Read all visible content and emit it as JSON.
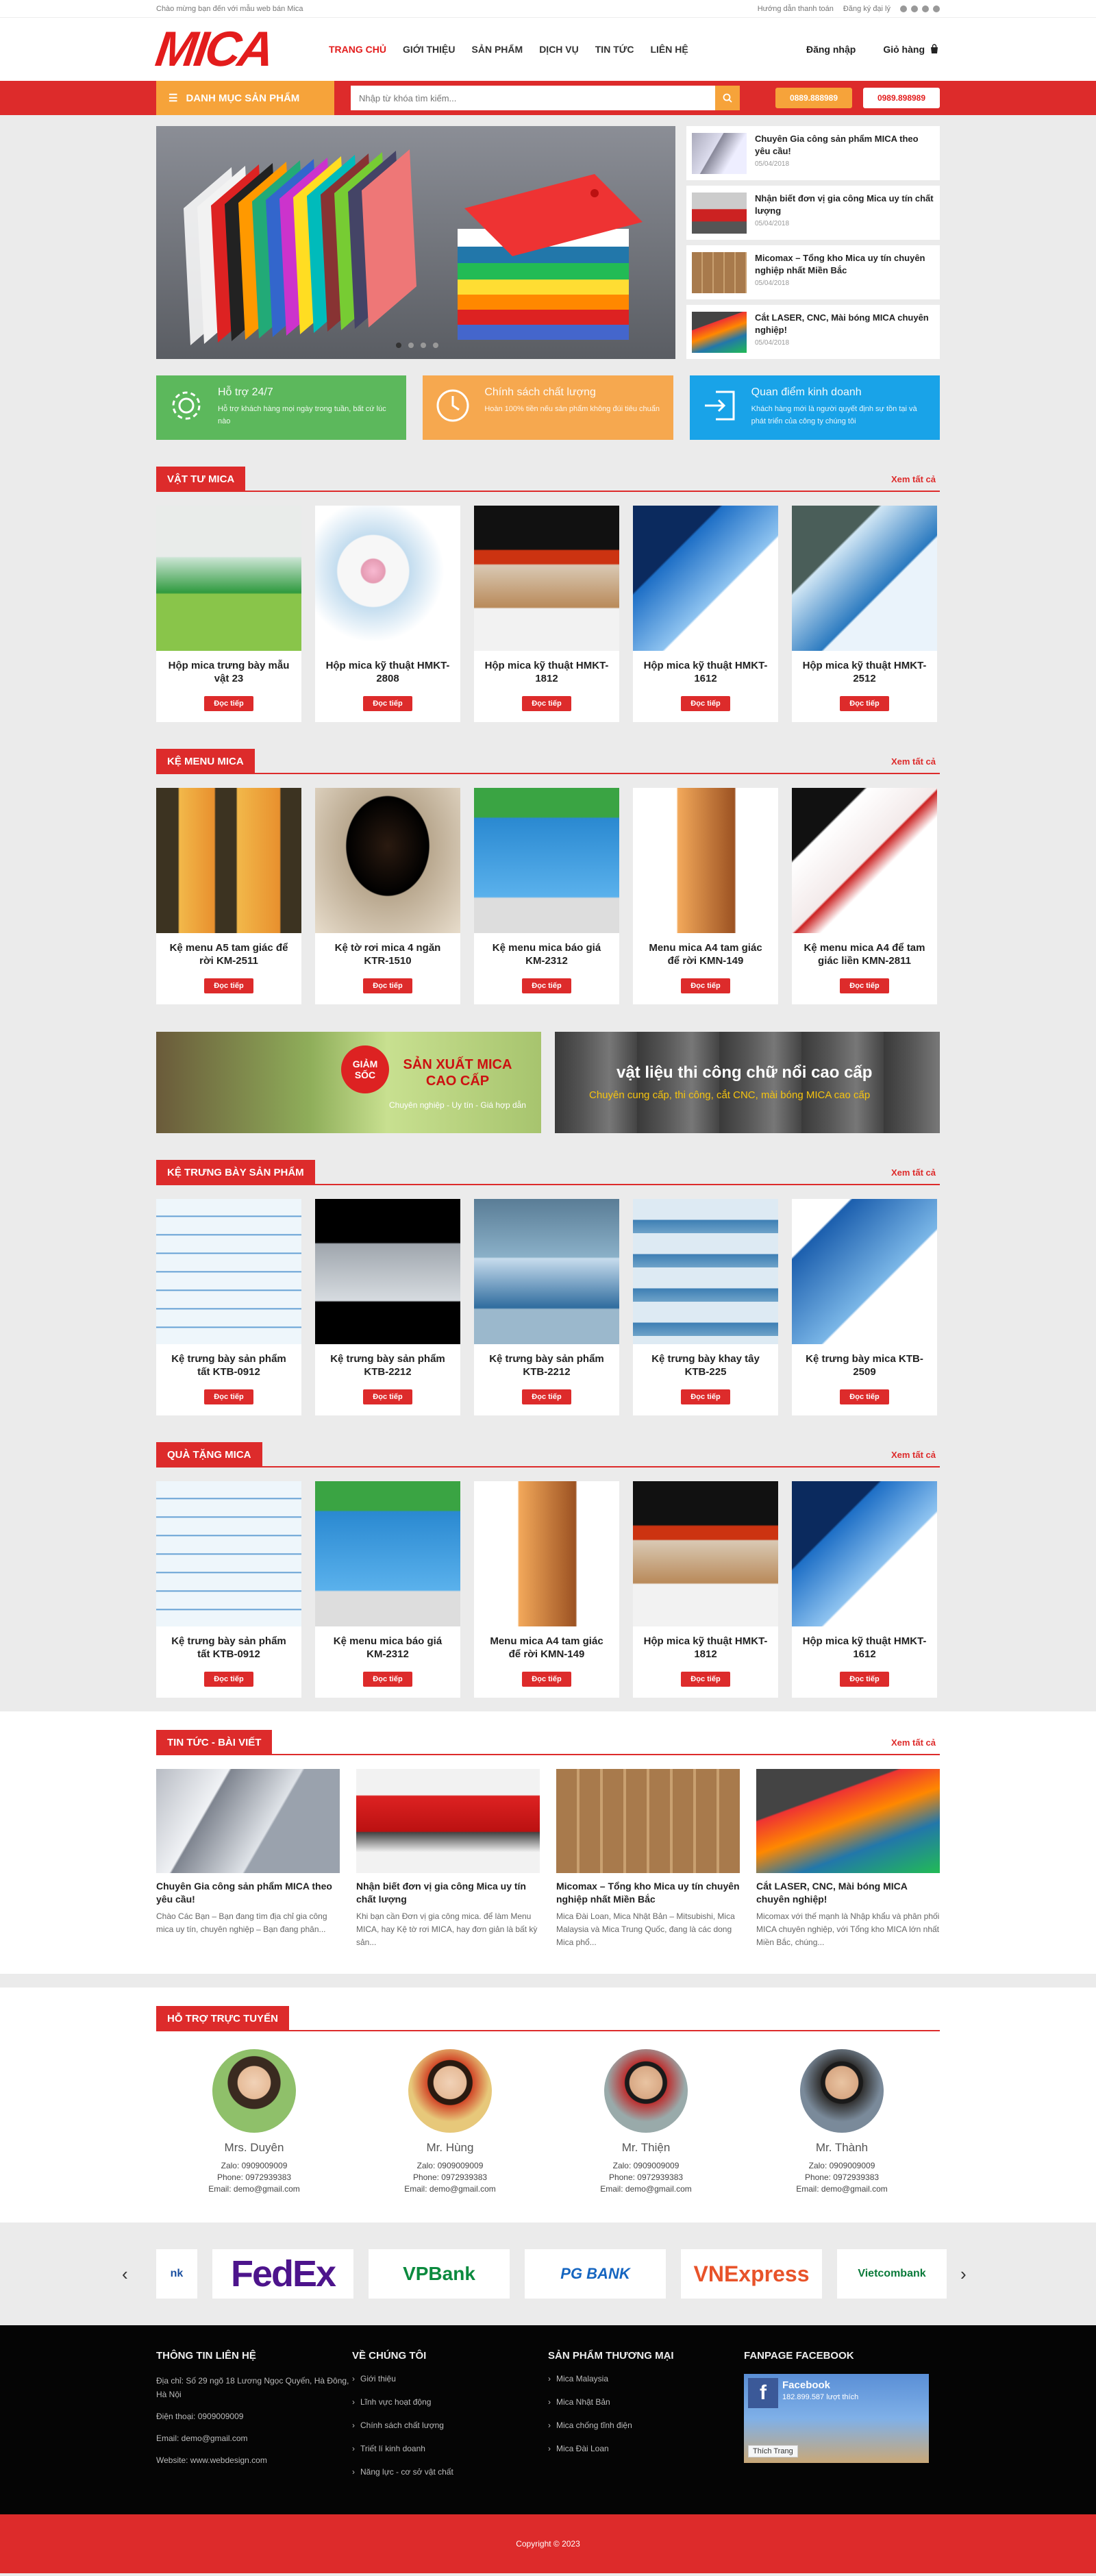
{
  "topbar": {
    "welcome": "Chào mừng bạn đến với mẫu web bán Mica",
    "guide": "Hướng dẫn thanh toán",
    "agent": "Đăng ký đại lý"
  },
  "nav": {
    "items": [
      "TRANG CHỦ",
      "GIỚI THIỆU",
      "SẢN PHẨM",
      "DỊCH VỤ",
      "TIN TỨC",
      "LIÊN HỆ"
    ],
    "login": "Đăng nhập",
    "cart": "Giỏ hàng"
  },
  "logo": "MICA",
  "search": {
    "category_label": "DANH MỤC SẢN PHẨM",
    "placeholder": "Nhập từ khóa tìm kiếm...",
    "phone1": "0889.888989",
    "phone2": "0989.898989"
  },
  "side_news": [
    {
      "title": "Chuyên Gia công sản phẩm MICA theo yêu cầu!",
      "date": "05/04/2018"
    },
    {
      "title": "Nhận biết đơn vị gia công Mica uy tín chất lượng",
      "date": "05/04/2018"
    },
    {
      "title": "Micomax – Tổng kho Mica uy tín chuyên nghiệp nhất Miền Bắc",
      "date": "05/04/2018"
    },
    {
      "title": "Cắt LASER, CNC, Mài bóng MICA chuyên nghiệp!",
      "date": "05/04/2018"
    }
  ],
  "features": [
    {
      "title": "Hỗ trợ 24/7",
      "text": "Hỗ trợ khách hàng mọi ngày trong tuần, bất cứ lúc nào",
      "color": "#5cb85c"
    },
    {
      "title": "Chính sách chất lượng",
      "text": "Hoàn 100% tiền nếu sản phẩm không đúi tiêu chuẩn",
      "color": "#f6a84f"
    },
    {
      "title": "Quan điểm kinh doanh",
      "text": "Khách hàng mới là người quyết định sự tồn tại và phát triển của công ty chúng tôi",
      "color": "#19a3e8"
    }
  ],
  "common": {
    "more": "Xem tất cả",
    "detail": "Đọc tiếp"
  },
  "sections": [
    {
      "title": "VẬT TƯ MICA",
      "items": [
        "Hộp mica trưng bày mẫu vật 23",
        "Hộp mica kỹ thuật HMKT-2808",
        "Hộp mica kỹ thuật HMKT-1812",
        "Hộp mica kỹ thuật HMKT-1612",
        "Hộp mica kỹ thuật HMKT-2512"
      ]
    },
    {
      "title": "KỆ MENU MICA",
      "items": [
        "Kệ menu A5 tam giác để rời KM-2511",
        "Kệ tờ rơi mica 4 ngăn KTR-1510",
        "Kệ menu mica báo giá KM-2312",
        "Menu mica A4 tam giác để rời KMN-149",
        "Kệ menu mica A4 để tam giác liền KMN-2811"
      ]
    },
    {
      "title": "KỆ TRƯNG BÀY SẢN PHẨM",
      "items": [
        "Kệ trưng bày sản phẩm tất KTB-0912",
        "Kệ trưng bày sản phẩm KTB-2212",
        "Kệ trưng bày sản phẩm KTB-2212",
        "Kệ trưng bày khay tây KTB-225",
        "Kệ trưng bày mica KTB-2509"
      ]
    },
    {
      "title": "QUÀ TẶNG MICA",
      "items": [
        "Kệ trưng bày sản phẩm tất KTB-0912",
        "Kệ menu mica báo giá KM-2312",
        "Menu mica A4 tam giác để rời KMN-149",
        "Hộp mica kỹ thuật HMKT-1812",
        "Hộp mica kỹ thuật HMKT-1612"
      ]
    }
  ],
  "banners": {
    "left_badge": "GIẢM SỐC",
    "left_title": "SẢN XUẤT MICA CAO CẤP",
    "left_sub": "Chuyên nghiệp - Uy tín - Giá hợp dẫn",
    "right_title": "vật liệu thi công chữ nổi cao cấp",
    "right_sub": "Chuyên cung cấp, thi công, cắt CNC, mài bóng MICA cao cấp"
  },
  "news": {
    "title": "TIN TỨC - BÀI VIẾT",
    "items": [
      {
        "title": "Chuyên Gia công sản phẩm MICA theo yêu cầu!",
        "excerpt": "Chào Các Bạn – Bạn đang tìm địa chỉ gia công mica uy tín, chuyên nghiệp – Bạn đang phân..."
      },
      {
        "title": "Nhận biết đơn vị gia công Mica uy tín chất lượng",
        "excerpt": "Khi bạn cần Đơn vị gia công mica. để làm Menu MICA, hay Kệ tờ rơi MICA, hay đơn giản là bất kỳ sản..."
      },
      {
        "title": "Micomax – Tổng kho Mica uy tín chuyên nghiệp nhất Miền Bắc",
        "excerpt": "Mica Đài Loan, Mica Nhật Bản – Mitsubishi, Mica Malaysia và Mica Trung Quốc, đang là các dong Mica phổ..."
      },
      {
        "title": "Cắt LASER, CNC, Mài bóng MICA chuyên nghiệp!",
        "excerpt": "Micomax với thế mạnh là Nhập khẩu và phân phối MICA chuyên nghiệp, với Tổng kho MICA lớn nhất Miền Bắc, chúng..."
      }
    ]
  },
  "support": {
    "title": "HỖ TRỢ TRỰC TUYẾN",
    "people": [
      {
        "name": "Mrs. Duyên",
        "zalo": "Zalo: 0909009009",
        "phone": "Phone: 0972939383",
        "email": "Email: demo@gmail.com"
      },
      {
        "name": "Mr. Hùng",
        "zalo": "Zalo: 0909009009",
        "phone": "Phone: 0972939383",
        "email": "Email: demo@gmail.com"
      },
      {
        "name": "Mr. Thiện",
        "zalo": "Zalo: 0909009009",
        "phone": "Phone: 0972939383",
        "email": "Email: demo@gmail.com"
      },
      {
        "name": "Mr. Thành",
        "zalo": "Zalo: 0909009009",
        "phone": "Phone: 0972939383",
        "email": "Email: demo@gmail.com"
      }
    ]
  },
  "brands": [
    "nk",
    "FedEx",
    "VPBank",
    "PG BANK",
    "VNExpress",
    "Vietcombank"
  ],
  "footer": {
    "contact_title": "THÔNG TIN LIÊN HỆ",
    "address": "Địa chỉ: Số 29 ngõ 18 Lương Ngọc Quyến, Hà Đông, Hà Nội",
    "phone": "Điện thoại: 0909009009",
    "email": "Email: demo@gmail.com",
    "website": "Website: www.webdesign.com",
    "about_title": "VỀ CHÚNG TÔI",
    "about": [
      "Giới thiệu",
      "Lĩnh vực hoạt động",
      "Chính sách chất lượng",
      "Triết lí kinh doanh",
      "Năng lực - cơ sở vật chất"
    ],
    "products_title": "SẢN PHẨM THƯƠNG MẠI",
    "products": [
      "Mica Malaysia",
      "Mica Nhật Bản",
      "Mica chống tĩnh điện",
      "Mica Đài Loan"
    ],
    "fb_title": "FANPAGE FACEBOOK",
    "fb_name": "Facebook",
    "fb_likes": "182.899.587 lượt thích",
    "fb_like_btn": "Thích Trang",
    "copyright": "Copyright © 2023"
  }
}
